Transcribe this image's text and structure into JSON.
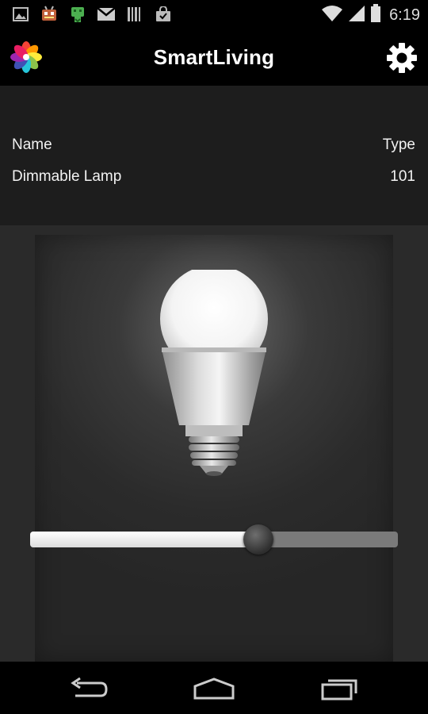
{
  "status_bar": {
    "time": "6:19",
    "left_icons": [
      "gallery-icon",
      "android-bot-icon",
      "android-download-icon",
      "gmail-icon",
      "barcode-icon",
      "shopping-bag-icon"
    ],
    "right_icons": [
      "wifi-icon",
      "signal-icon",
      "battery-icon"
    ]
  },
  "action_bar": {
    "title": "SmartLiving",
    "logo_icon": "flower-logo-icon",
    "settings_icon": "gear-icon"
  },
  "device_info": {
    "name_label": "Name",
    "type_label": "Type",
    "name_value": "Dimmable Lamp",
    "type_value": "101"
  },
  "dimmer": {
    "level": 0.62,
    "fill_color": "#ffffff",
    "track_color": "#7a7a7a"
  },
  "nav_bar": {
    "icons": [
      "back-icon",
      "home-icon",
      "recent-apps-icon"
    ]
  },
  "colors": {
    "background": "#000000",
    "panel": "#1d1d1d",
    "lamp_area": "#2a2a2a"
  }
}
